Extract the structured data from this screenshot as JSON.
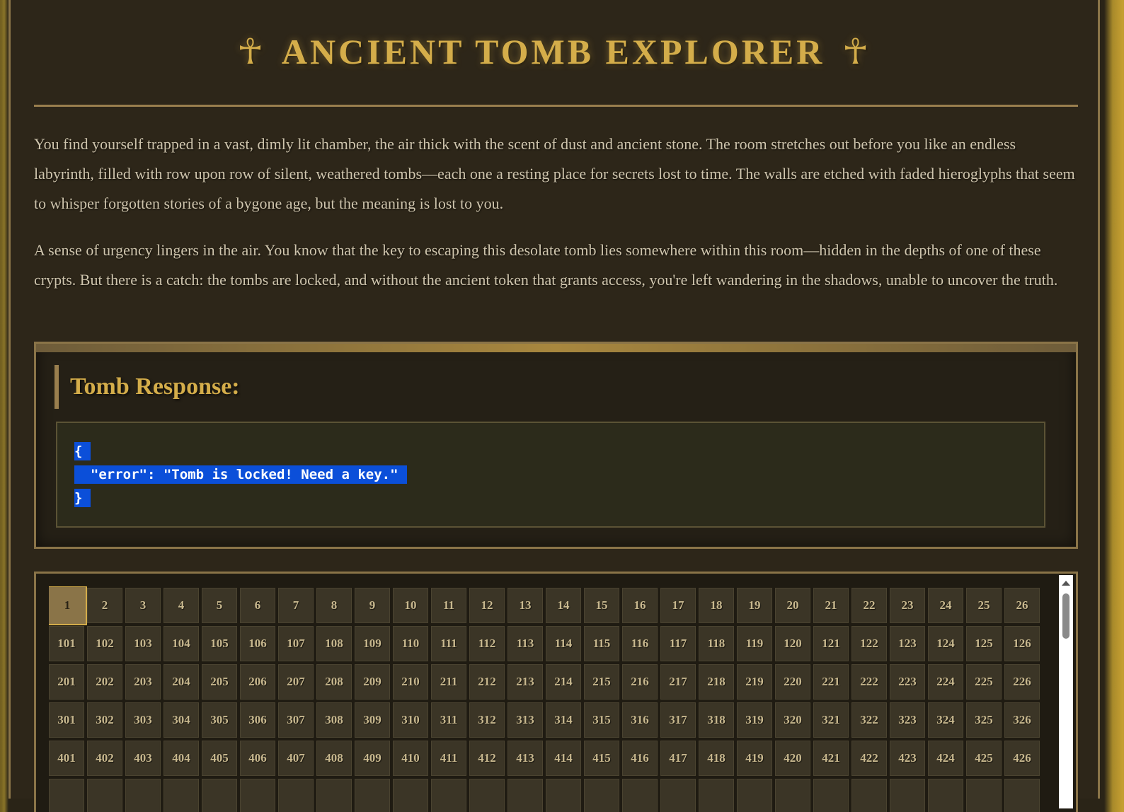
{
  "header": {
    "left_symbol": "☥",
    "title": "ANCIENT TOMB EXPLORER",
    "right_symbol": "☥"
  },
  "intro": {
    "paragraph1": "You find yourself trapped in a vast, dimly lit chamber, the air thick with the scent of dust and ancient stone. The room stretches out before you like an endless labyrinth, filled with row upon row of silent, weathered tombs—each one a resting place for secrets lost to time. The walls are etched with faded hieroglyphs that seem to whisper forgotten stories of a bygone age, but the meaning is lost to you.",
    "paragraph2": "A sense of urgency lingers in the air. You know that the key to escaping this desolate tomb lies somewhere within this room—hidden in the depths of one of these crypts. But there is a catch: the tombs are locked, and without the ancient token that grants access, you're left wandering in the shadows, unable to uncover the truth."
  },
  "response": {
    "heading": "Tomb Response:",
    "code_line1": "{",
    "code_line2": "  \"error\": \"Tomb is locked! Need a key.\"",
    "code_line3": "}"
  },
  "tomb_grid": {
    "selected": "1",
    "rows": [
      [
        "1",
        "2",
        "3",
        "4",
        "5",
        "6",
        "7",
        "8",
        "9",
        "10",
        "11",
        "12",
        "13",
        "14",
        "15",
        "16",
        "17",
        "18",
        "19",
        "20",
        "21",
        "22",
        "23",
        "24",
        "25",
        "26"
      ],
      [
        "101",
        "102",
        "103",
        "104",
        "105",
        "106",
        "107",
        "108",
        "109",
        "110",
        "111",
        "112",
        "113",
        "114",
        "115",
        "116",
        "117",
        "118",
        "119",
        "120",
        "121",
        "122",
        "123",
        "124",
        "125",
        "126"
      ],
      [
        "201",
        "202",
        "203",
        "204",
        "205",
        "206",
        "207",
        "208",
        "209",
        "210",
        "211",
        "212",
        "213",
        "214",
        "215",
        "216",
        "217",
        "218",
        "219",
        "220",
        "221",
        "222",
        "223",
        "224",
        "225",
        "226"
      ],
      [
        "301",
        "302",
        "303",
        "304",
        "305",
        "306",
        "307",
        "308",
        "309",
        "310",
        "311",
        "312",
        "313",
        "314",
        "315",
        "316",
        "317",
        "318",
        "319",
        "320",
        "321",
        "322",
        "323",
        "324",
        "325",
        "326"
      ],
      [
        "401",
        "402",
        "403",
        "404",
        "405",
        "406",
        "407",
        "408",
        "409",
        "410",
        "411",
        "412",
        "413",
        "414",
        "415",
        "416",
        "417",
        "418",
        "419",
        "420",
        "421",
        "422",
        "423",
        "424",
        "425",
        "426"
      ],
      [
        "",
        "",
        "",
        "",
        "",
        "",
        "",
        "",
        "",
        "",
        "",
        "",
        "",
        "",
        "",
        "",
        "",
        "",
        "",
        "",
        "",
        "",
        "",
        "",
        "",
        ""
      ]
    ]
  },
  "colors": {
    "gold": "#d4ad4a",
    "panel_border": "#8a7448",
    "selection": "#0b4fd9"
  }
}
